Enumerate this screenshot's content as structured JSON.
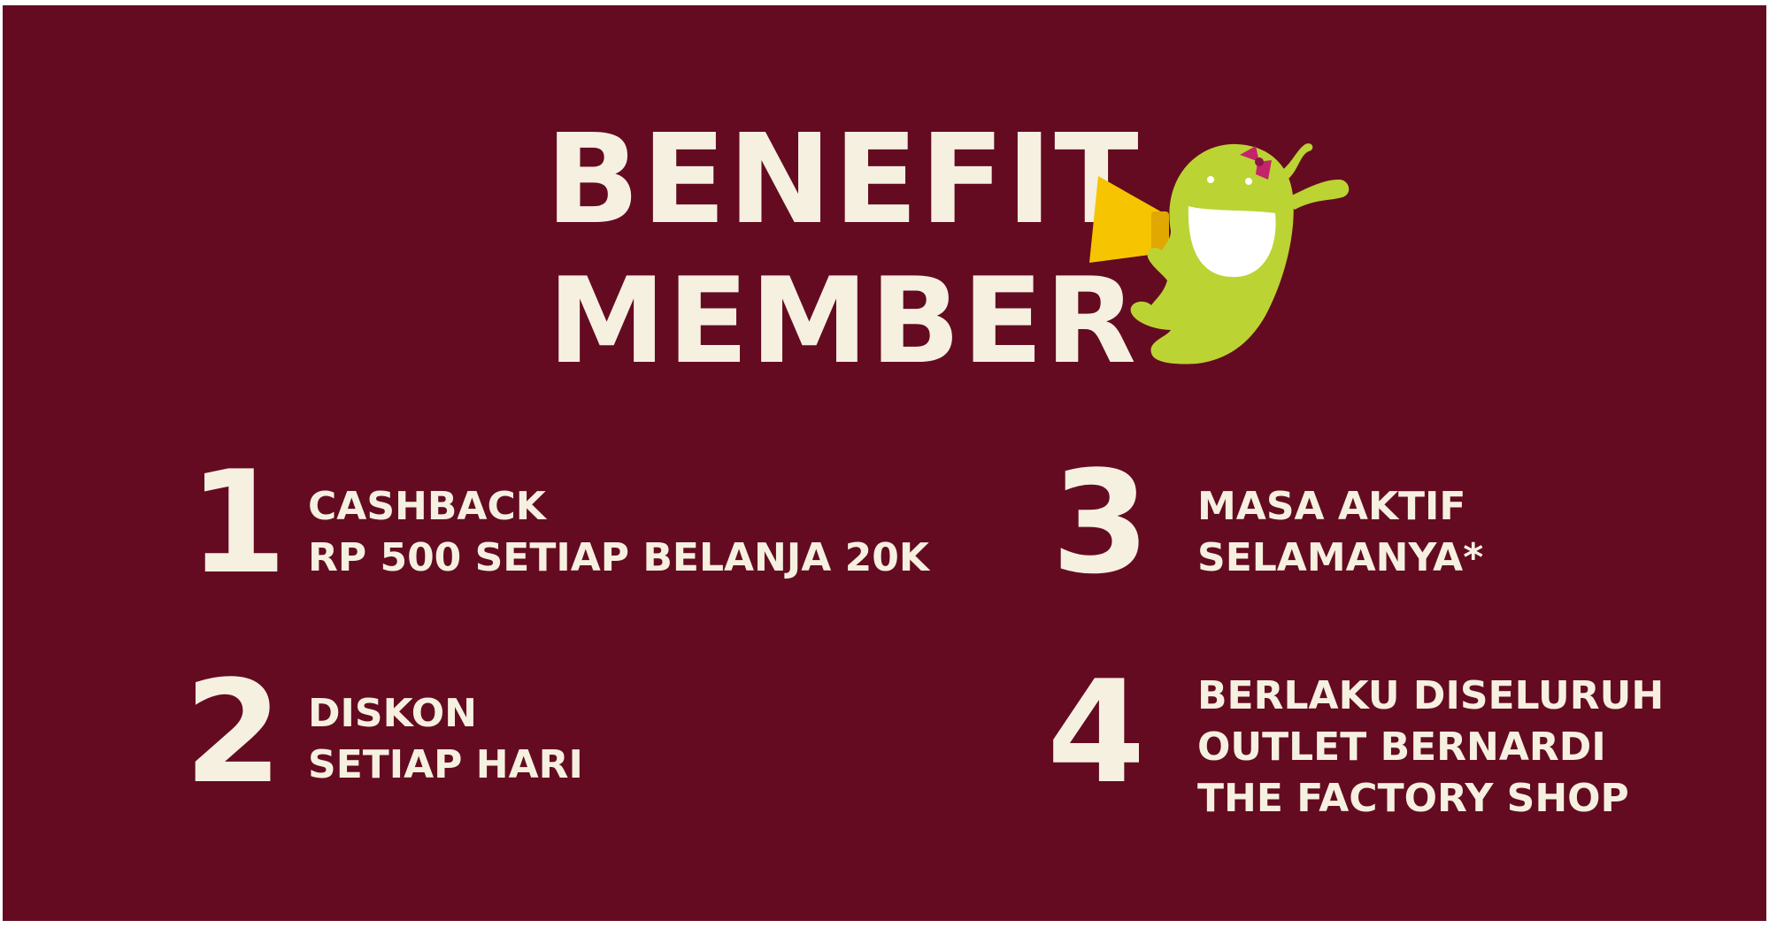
{
  "colors": {
    "background": "#640b21",
    "text": "#f6f0e1",
    "mascot_body": "#bcd334",
    "megaphone": "#f6c400",
    "bow": "#c4246b"
  },
  "title": {
    "line1": "BENEFIT",
    "line2": "MEMBER"
  },
  "mascot": {
    "icon": "green-monster-megaphone-icon"
  },
  "benefits": [
    {
      "number": "1",
      "lines": [
        "CASHBACK",
        "RP 500 SETIAP BELANJA 20K"
      ]
    },
    {
      "number": "2",
      "lines": [
        "DISKON",
        "SETIAP HARI"
      ]
    },
    {
      "number": "3",
      "lines": [
        "MASA AKTIF",
        "SELAMANYA*"
      ]
    },
    {
      "number": "4",
      "lines": [
        "BERLAKU DISELURUH",
        "OUTLET BERNARDI",
        "THE FACTORY SHOP"
      ]
    }
  ]
}
